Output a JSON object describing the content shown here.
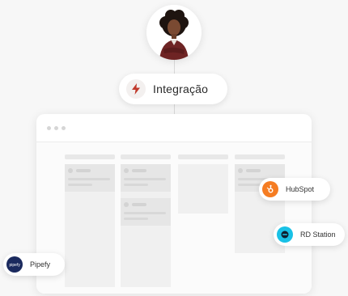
{
  "integration": {
    "label": "Integração",
    "icon": "lightning-bolt-icon"
  },
  "avatar": {
    "icon": "person-avatar"
  },
  "window": {
    "controls": [
      "dot",
      "dot",
      "dot"
    ]
  },
  "integrations": [
    {
      "name": "HubSpot",
      "icon": "hubspot-logo",
      "color": "#f57c22"
    },
    {
      "name": "RD Station",
      "icon": "rd-station-logo",
      "color": "#18c1e6"
    },
    {
      "name": "Pipefy",
      "icon": "pipefy-logo",
      "color": "#1b2a5e"
    }
  ],
  "colors": {
    "bolt": "#c0392b",
    "background": "#f7f7f7"
  }
}
